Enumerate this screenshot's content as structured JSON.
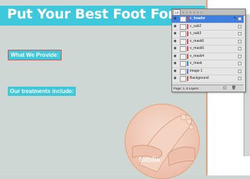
{
  "document": {
    "headline": "Put Your Best Foot Forward!",
    "section_1": "What We Provide:",
    "section_2": "Our treatments include:",
    "watermark": "fotolia"
  },
  "layers_panel": {
    "tab_label": "LA",
    "tab_icons": "◊ ◊ ◊ ◊ ◊ ◊",
    "footer_text": "Page: 1, 9 Layers",
    "layers": [
      {
        "name": "c_header",
        "color": "#e04848",
        "selected": true
      },
      {
        "name": "c_sub2",
        "color": "#e04848",
        "selected": false
      },
      {
        "name": "c_sub3",
        "color": "#e04848",
        "selected": false
      },
      {
        "name": "v_mask6",
        "color": "#e04848",
        "selected": false
      },
      {
        "name": "v_mask5",
        "color": "#e04848",
        "selected": false
      },
      {
        "name": "v_mask4",
        "color": "#e04848",
        "selected": false
      },
      {
        "name": "v_mask",
        "color": "#3f7fe0",
        "selected": false
      },
      {
        "name": "image 1",
        "color": "#3f7fe0",
        "selected": false
      },
      {
        "name": "Background",
        "color": "#e04848",
        "selected": false
      }
    ]
  },
  "colors": {
    "accent": "#3ec8dc",
    "guide": "#e9a070",
    "selection": "#3f7fe0"
  }
}
